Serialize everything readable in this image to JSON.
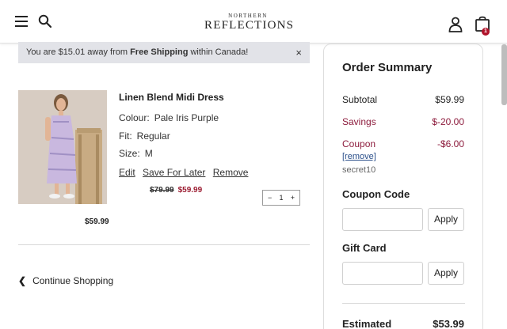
{
  "header": {
    "logo_top": "NORTHERN",
    "logo_main": "REFLECTIONS",
    "bag_count": "1"
  },
  "shipping_bar": {
    "prefix": "You are $15.01 away from ",
    "bold": "Free Shipping",
    "suffix": " within Canada!",
    "close": "×"
  },
  "cart_item": {
    "name": "Linen Blend Midi Dress",
    "colour_label": "Colour:",
    "colour_value": "Pale Iris Purple",
    "fit_label": "Fit:",
    "fit_value": "Regular",
    "size_label": "Size:",
    "size_value": "M",
    "edit": "Edit",
    "save_for_later": "Save For Later",
    "remove": "Remove",
    "original_price": "$79.99",
    "sale_price": "$59.99",
    "qty_minus": "−",
    "qty_value": "1",
    "qty_plus": "+",
    "line_total": "$59.99"
  },
  "continue_shopping": "Continue Shopping",
  "summary": {
    "title": "Order Summary",
    "subtotal_label": "Subtotal",
    "subtotal_value": "$59.99",
    "savings_label": "Savings",
    "savings_value": "$-20.00",
    "coupon_label": "Coupon",
    "coupon_value": "-$6.00",
    "coupon_remove": "[remove]",
    "coupon_code": "secret10",
    "coupon_code_title": "Coupon Code",
    "apply_label": "Apply",
    "gift_card_title": "Gift Card",
    "estimated_label": "Estimated",
    "estimated_value": "$53.99"
  },
  "colors": {
    "accent_red": "#8d1c3d",
    "badge_red": "#b0132b",
    "banner_bg": "#e2e3e8"
  },
  "icons": [
    "menu-icon",
    "search-icon",
    "user-icon",
    "shopping-bag-icon",
    "close-icon",
    "chevron-left-icon"
  ]
}
